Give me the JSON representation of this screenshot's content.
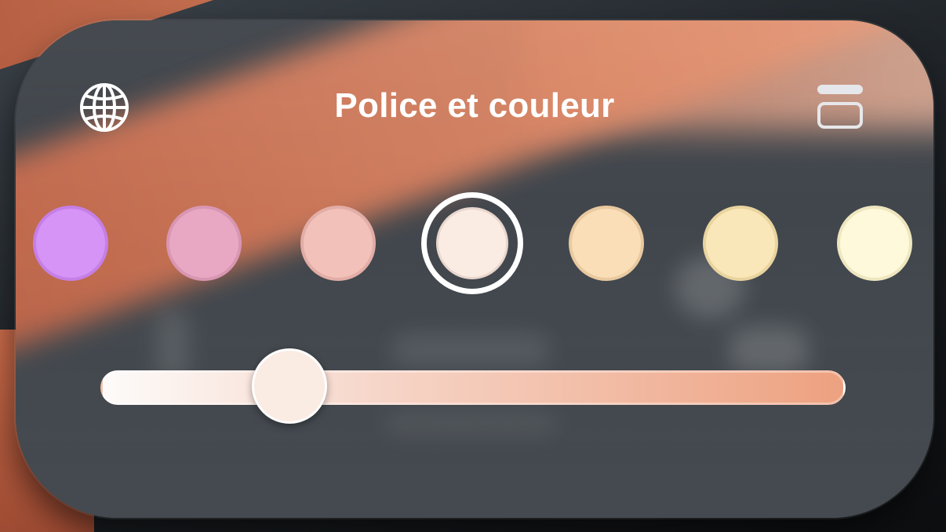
{
  "panel": {
    "title": "Police et couleur"
  },
  "icons": {
    "left": "globe-icon",
    "right": "card-stack-icon"
  },
  "swatches": [
    {
      "name": "violet",
      "color": "#d694f6",
      "border": "#c57fe6"
    },
    {
      "name": "pink",
      "color": "#e8a8c4",
      "border": "#d896b2"
    },
    {
      "name": "salmon",
      "color": "#f2c1ba",
      "border": "#e2ada6"
    },
    {
      "name": "blush",
      "color": "#faebe3",
      "border": "#e8d6cd",
      "selected": true
    },
    {
      "name": "peach",
      "color": "#f9deb8",
      "border": "#e9c99f"
    },
    {
      "name": "butter",
      "color": "#fae7b9",
      "border": "#e9d49f"
    },
    {
      "name": "cream",
      "color": "#fef9da",
      "border": "#eee6bf"
    }
  ],
  "slider": {
    "value": 0.23,
    "gradient_start": "#fdfbfa",
    "gradient_end": "#eda180",
    "thumb_color": "#faebe3"
  },
  "colors": {
    "title": "#ffffff",
    "ring": "#ffffff"
  }
}
